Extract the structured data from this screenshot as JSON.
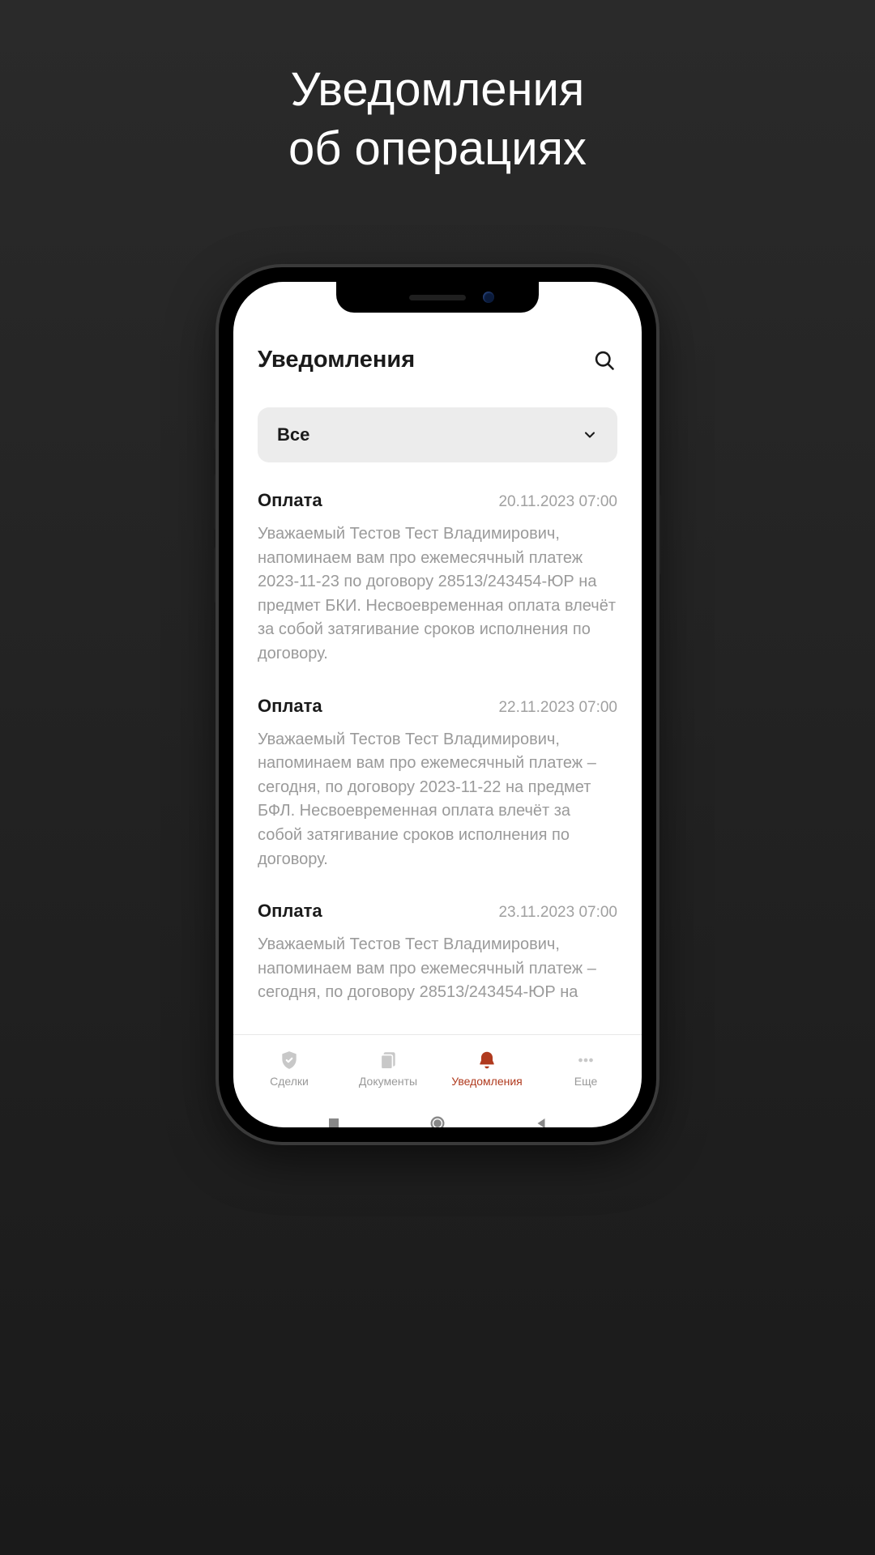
{
  "hero": {
    "line1": "Уведомления",
    "line2": "об операциях"
  },
  "header": {
    "title": "Уведомления"
  },
  "filter": {
    "selected": "Все"
  },
  "notifications": [
    {
      "title": "Оплата",
      "timestamp": "20.11.2023 07:00",
      "body": "Уважаемый Тестов Тест Владимирович, напоминаем вам про ежемесячный платеж 2023-11-23 по договору 28513/243454-ЮР на предмет БКИ. Несвоевременная оплата влечёт за собой затягивание сроков исполнения по договору."
    },
    {
      "title": "Оплата",
      "timestamp": "22.11.2023 07:00",
      "body": "Уважаемый Тестов Тест Владимирович, напоминаем вам про ежемесячный платеж – сегодня, по договору 2023-11-22 на предмет БФЛ. Несвоевременная оплата влечёт за собой затягивание сроков исполнения по договору."
    },
    {
      "title": "Оплата",
      "timestamp": "23.11.2023 07:00",
      "body": "Уважаемый Тестов Тест Владимирович, напоминаем вам про ежемесячный платеж – сегодня, по договору 28513/243454-ЮР на"
    }
  ],
  "tabs": [
    {
      "label": "Сделки",
      "icon": "shield-check-icon",
      "active": false
    },
    {
      "label": "Документы",
      "icon": "documents-icon",
      "active": false
    },
    {
      "label": "Уведомления",
      "icon": "bell-icon",
      "active": true
    },
    {
      "label": "Еще",
      "icon": "more-icon",
      "active": false
    }
  ],
  "colors": {
    "accent": "#b03a1e",
    "muted": "#999999",
    "textBody": "#9a9a9a"
  }
}
